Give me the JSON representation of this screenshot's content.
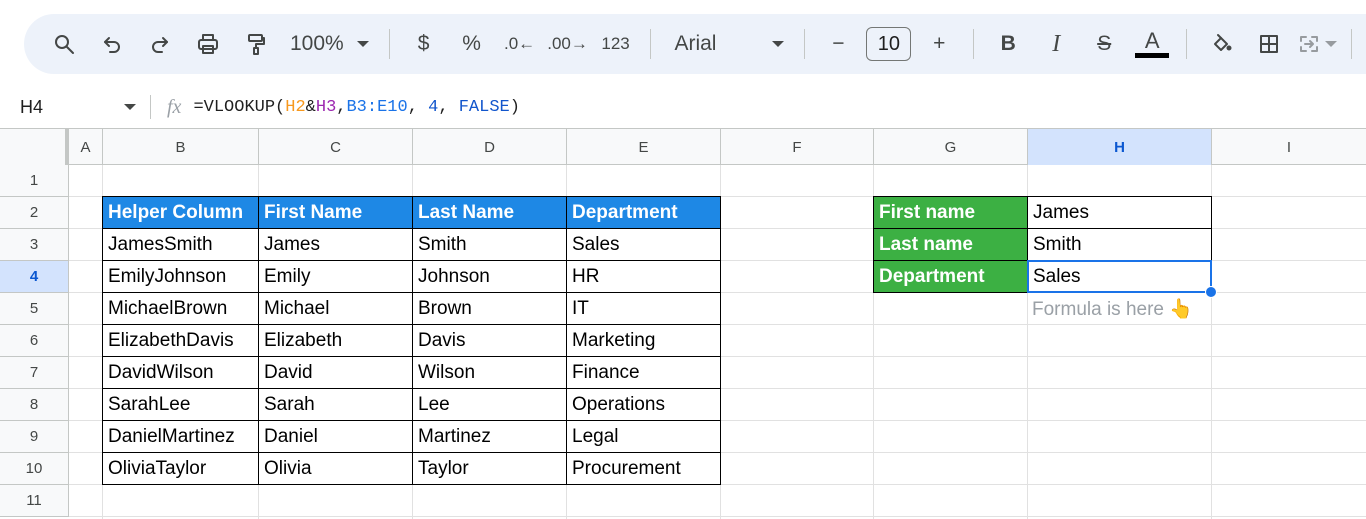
{
  "toolbar": {
    "zoom": "100%",
    "currency": "$",
    "percent": "%",
    "decrease_decimal": ".0",
    "increase_decimal": ".00",
    "number_format": "123",
    "font": "Arial",
    "font_size": "10",
    "minus": "−",
    "plus": "+",
    "bold": "B",
    "italic": "I",
    "strikethrough": "S",
    "text_color_letter": "A"
  },
  "formula_bar": {
    "cell_ref": "H4",
    "fx": "fx",
    "formula_parts": [
      "=VLOOKUP(",
      "H2",
      "&",
      "H3",
      ",",
      "B3:E10",
      ", ",
      "4",
      ", ",
      "FALSE",
      ")"
    ]
  },
  "columns": [
    "A",
    "B",
    "C",
    "D",
    "E",
    "F",
    "G",
    "H",
    "I"
  ],
  "rows": [
    "1",
    "2",
    "3",
    "4",
    "5",
    "6",
    "7",
    "8",
    "9",
    "10",
    "11"
  ],
  "table": {
    "headers": [
      "Helper Column",
      "First Name",
      "Last Name",
      "Department"
    ],
    "rows": [
      [
        "JamesSmith",
        "James",
        "Smith",
        "Sales"
      ],
      [
        "EmilyJohnson",
        "Emily",
        "Johnson",
        "HR"
      ],
      [
        "MichaelBrown",
        "Michael",
        "Brown",
        "IT"
      ],
      [
        "ElizabethDavis",
        "Elizabeth",
        "Davis",
        "Marketing"
      ],
      [
        "DavidWilson",
        "David",
        "Wilson",
        "Finance"
      ],
      [
        "SarahLee",
        "Sarah",
        "Lee",
        "Operations"
      ],
      [
        "DanielMartinez",
        "Daniel",
        "Martinez",
        "Legal"
      ],
      [
        "OliviaTaylor",
        "Olivia",
        "Taylor",
        "Procurement"
      ]
    ]
  },
  "lookup": {
    "labels": [
      "First name",
      "Last name",
      "Department"
    ],
    "values": [
      "James",
      "Smith",
      "Sales"
    ],
    "note": "Formula is here 👆"
  },
  "colors": {
    "table_header": "#1e88e5",
    "lookup_header": "#3cb043",
    "selection": "#1a73e8"
  }
}
